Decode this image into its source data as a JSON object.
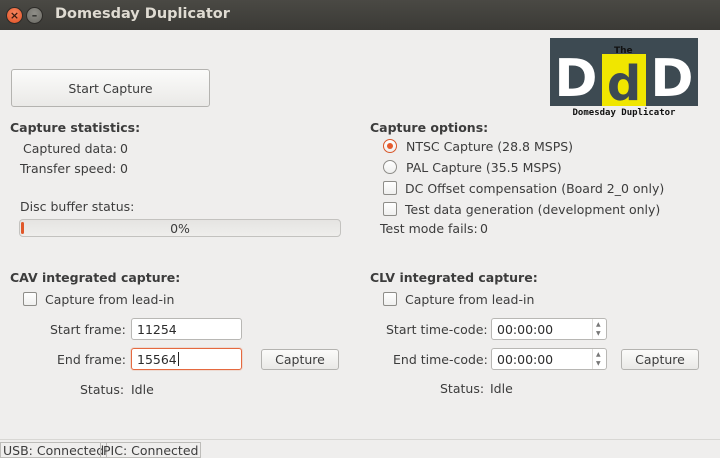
{
  "window": {
    "title": "Domesday Duplicator"
  },
  "logo": {
    "text_top": "The",
    "letters": [
      "D",
      "d",
      "D"
    ],
    "text_bottom": "Domesday Duplicator",
    "colors": {
      "dark": "#3d4a52",
      "yellow": "#f0e600"
    }
  },
  "start_capture_label": "Start Capture",
  "capture_statistics": {
    "heading": "Capture statistics:",
    "captured_data_label": "Captured data:",
    "captured_data_value": "0",
    "transfer_speed_label": "Transfer speed:",
    "transfer_speed_value": "0"
  },
  "disc_buffer": {
    "label": "Disc buffer status:",
    "value_text": "0%",
    "fraction": 0.0
  },
  "capture_options": {
    "heading": "Capture options:",
    "ntsc_label": "NTSC Capture (28.8 MSPS)",
    "pal_label": "PAL Capture (35.5 MSPS)",
    "selected": "ntsc",
    "dc_offset_label": "DC Offset compensation (Board 2_0 only)",
    "test_data_label": "Test data generation (development only)",
    "test_mode_fails_label": "Test mode fails:",
    "test_mode_fails_value": "0"
  },
  "cav": {
    "heading": "CAV integrated capture:",
    "lead_in_label": "Capture from lead-in",
    "start_frame_label": "Start frame:",
    "start_frame_value": "11254",
    "end_frame_label": "End frame:",
    "end_frame_value": "15564",
    "capture_label": "Capture",
    "status_label": "Status:",
    "status_value": "Idle"
  },
  "clv": {
    "heading": "CLV integrated capture:",
    "lead_in_label": "Capture from lead-in",
    "start_timecode_label": "Start time-code:",
    "start_timecode_value": "00:00:00",
    "end_timecode_label": "End time-code:",
    "end_timecode_value": "00:00:00",
    "capture_label": "Capture",
    "status_label": "Status:",
    "status_value": "Idle"
  },
  "statusbar": {
    "usb": "USB: Connected",
    "pic": "PIC: Connected"
  },
  "colors": {
    "accent": "#e05a2b",
    "titlebar": "#3c3b37",
    "background": "#efeeed"
  }
}
